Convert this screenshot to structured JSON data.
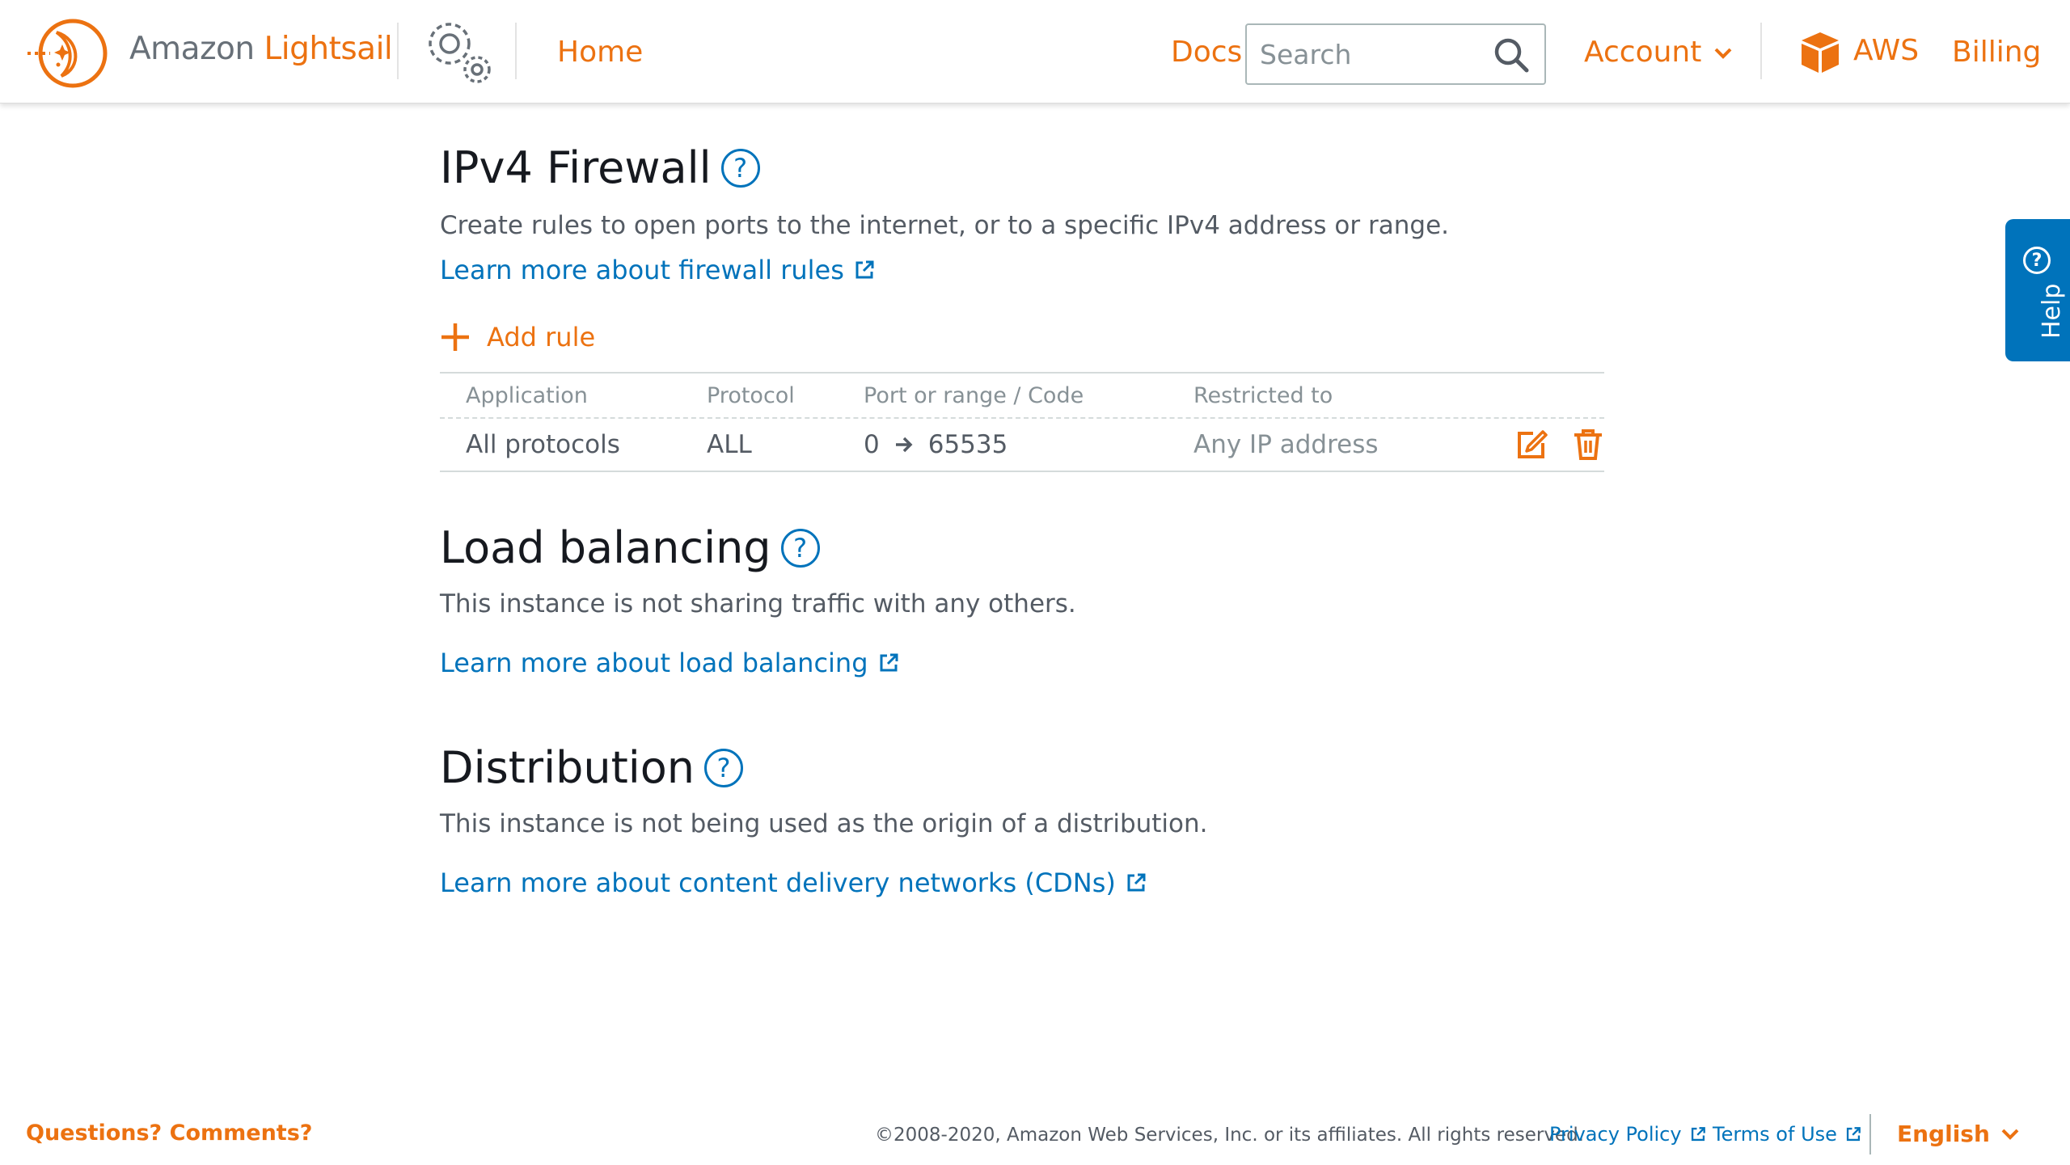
{
  "header": {
    "brand_prefix": "Amazon",
    "brand_name": "Lightsail",
    "home_label": "Home",
    "docs_label": "Docs",
    "search_placeholder": "Search",
    "account_label": "Account",
    "aws_label": "AWS",
    "billing_label": "Billing"
  },
  "firewall": {
    "title": "IPv4 Firewall",
    "help_icon": "?",
    "description": "Create rules to open ports to the internet, or to a specific IPv4 address or range.",
    "learn_more": "Learn more about firewall rules",
    "add_rule_label": "Add rule",
    "columns": [
      "Application",
      "Protocol",
      "Port or range / Code",
      "Restricted to"
    ],
    "rules": [
      {
        "application": "All protocols",
        "protocol": "ALL",
        "port_from": "0",
        "port_to": "65535",
        "restricted_to": "Any IP address"
      }
    ]
  },
  "load_balancing": {
    "title": "Load balancing",
    "help_icon": "?",
    "description": "This instance is not sharing traffic with any others.",
    "learn_more": "Learn more about load balancing"
  },
  "distribution": {
    "title": "Distribution",
    "help_icon": "?",
    "description": "This instance is not being used as the origin of a distribution.",
    "learn_more": "Learn more about content delivery networks (CDNs)"
  },
  "help_tab": {
    "label": "Help",
    "icon": "?"
  },
  "footer": {
    "questions": "Questions? Comments?",
    "copyright": "©2008-2020, Amazon Web Services, Inc. or its affiliates. All rights reserved.",
    "privacy": "Privacy Policy",
    "terms": "Terms of Use",
    "language": "English"
  },
  "colors": {
    "accent": "#ec7211",
    "link": "#0073bb",
    "text": "#545b64",
    "heading": "#16191f"
  },
  "icons": [
    "lightsail-logo-icon",
    "gears-icon",
    "search-icon",
    "chevron-down-icon",
    "aws-box-icon",
    "question-icon",
    "external-link-icon",
    "plus-icon",
    "arrow-right-icon",
    "edit-icon",
    "trash-icon"
  ]
}
